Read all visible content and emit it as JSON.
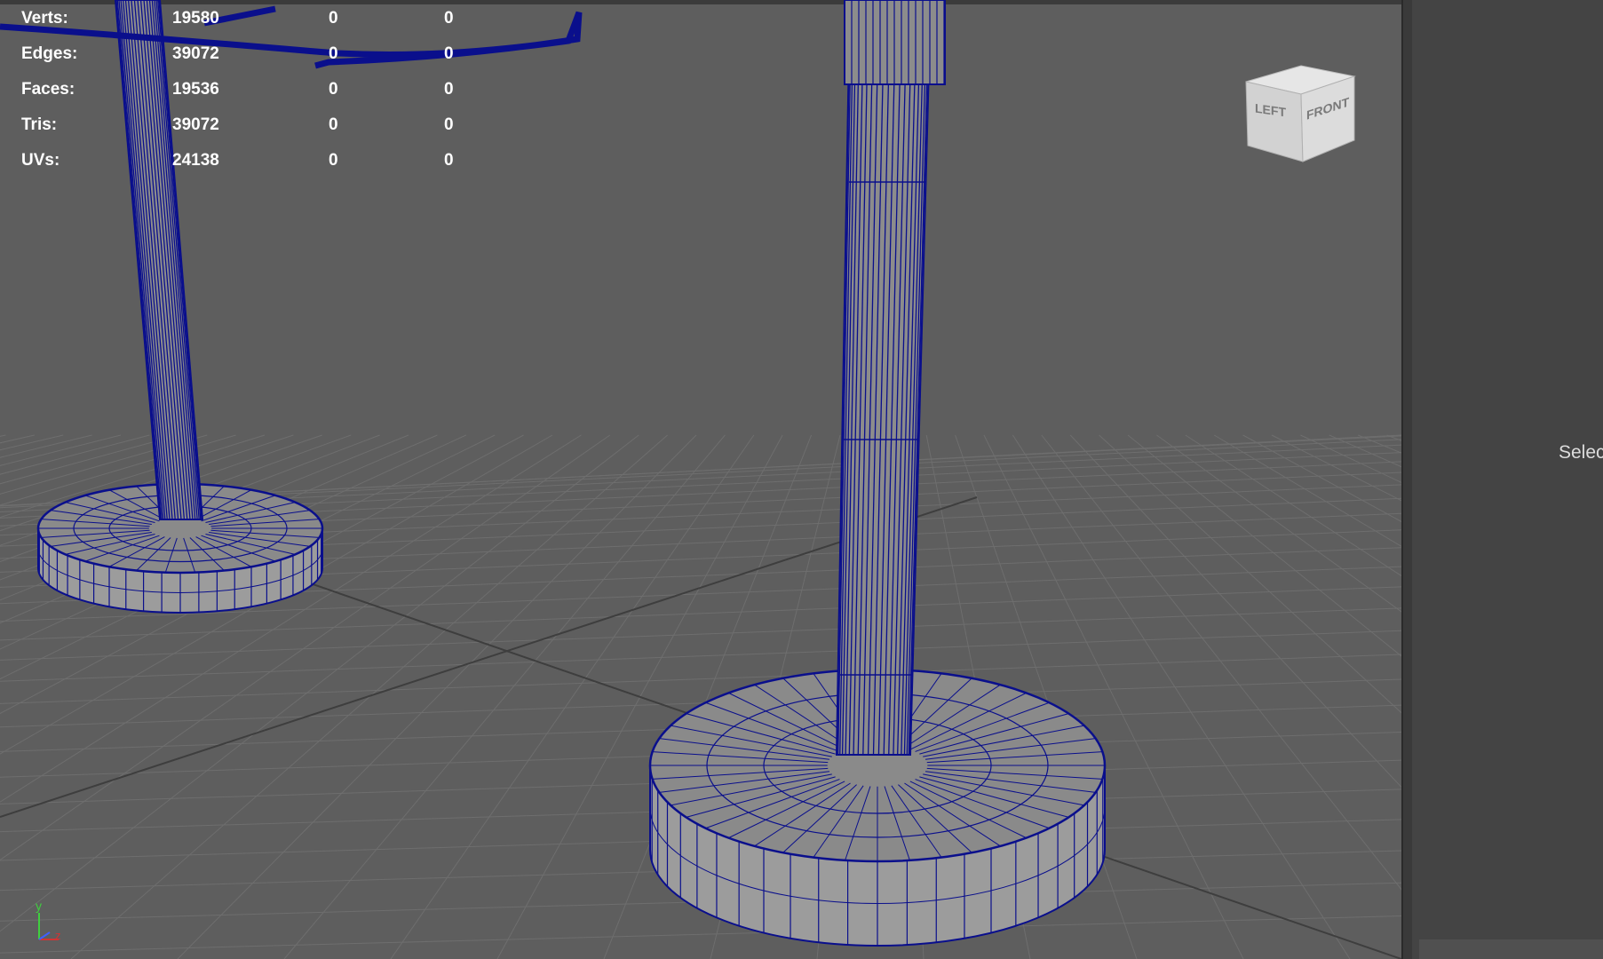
{
  "hud": {
    "rows": [
      {
        "label": "Verts:",
        "v1": "19580",
        "v2": "0",
        "v3": "0"
      },
      {
        "label": "Edges:",
        "v1": "39072",
        "v2": "0",
        "v3": "0"
      },
      {
        "label": "Faces:",
        "v1": "19536",
        "v2": "0",
        "v3": "0"
      },
      {
        "label": "Tris:",
        "v1": "39072",
        "v2": "0",
        "v3": "0"
      },
      {
        "label": "UVs:",
        "v1": "24138",
        "v2": "0",
        "v3": "0"
      }
    ]
  },
  "viewcube": {
    "left_label": "LEFT",
    "front_label": "FRONT"
  },
  "axis": {
    "y_label": "y",
    "z_label": "z"
  },
  "side_panel": {
    "select_text": "Selec"
  },
  "colors": {
    "viewport_bg": "#5e5e5e",
    "wire": "#0a0f8c",
    "grid": "#6e6e6e"
  }
}
